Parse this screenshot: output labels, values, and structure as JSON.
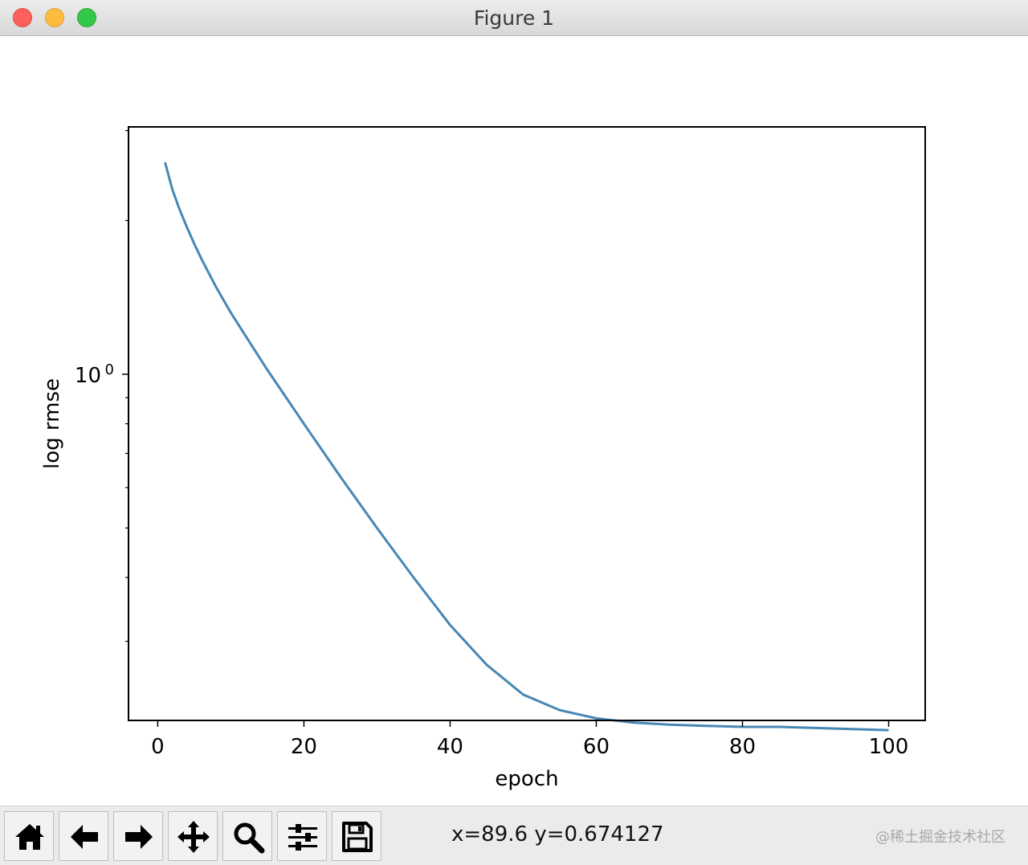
{
  "window": {
    "title": "Figure 1"
  },
  "toolbar": {
    "buttons": [
      {
        "name": "home",
        "icon": "home-icon"
      },
      {
        "name": "back",
        "icon": "arrow-left-icon"
      },
      {
        "name": "forward",
        "icon": "arrow-right-icon"
      },
      {
        "name": "pan",
        "icon": "move-icon"
      },
      {
        "name": "zoom",
        "icon": "magnifier-icon"
      },
      {
        "name": "configure-subplots",
        "icon": "sliders-icon"
      },
      {
        "name": "save",
        "icon": "floppy-disk-icon"
      }
    ],
    "coords": "x=89.6 y=0.674127",
    "watermark": "@稀土掘金技术社区"
  },
  "chart_data": {
    "type": "line",
    "title": "",
    "xlabel": "epoch",
    "ylabel": "log rmse",
    "xlim": [
      -4,
      105
    ],
    "ylim": [
      0.21,
      3.05
    ],
    "yscale": "log",
    "xticks": [
      0,
      20,
      40,
      60,
      80,
      100
    ],
    "xtick_labels": [
      "0",
      "20",
      "40",
      "60",
      "80",
      "100"
    ],
    "ytick_major": [
      1.0
    ],
    "ytick_major_label": "10",
    "ytick_major_label_exponent": "0",
    "ytick_minor": [
      0.3,
      0.4,
      0.5,
      0.6,
      0.7,
      0.8,
      0.9,
      2.0,
      3.0
    ],
    "grid": false,
    "color": "#4787b4",
    "series": [
      {
        "x": [
          1,
          2,
          3,
          4,
          5,
          6,
          8,
          10,
          12,
          15,
          20,
          25,
          30,
          35,
          40,
          45,
          50,
          55,
          60,
          65,
          70,
          75,
          80,
          85,
          90,
          95,
          100
        ],
        "y": [
          2.6,
          2.3,
          2.1,
          1.94,
          1.8,
          1.68,
          1.48,
          1.32,
          1.19,
          1.02,
          0.8,
          0.63,
          0.5,
          0.4,
          0.323,
          0.27,
          0.236,
          0.22,
          0.212,
          0.208,
          0.206,
          0.205,
          0.204,
          0.204,
          0.203,
          0.202,
          0.201
        ]
      }
    ]
  }
}
